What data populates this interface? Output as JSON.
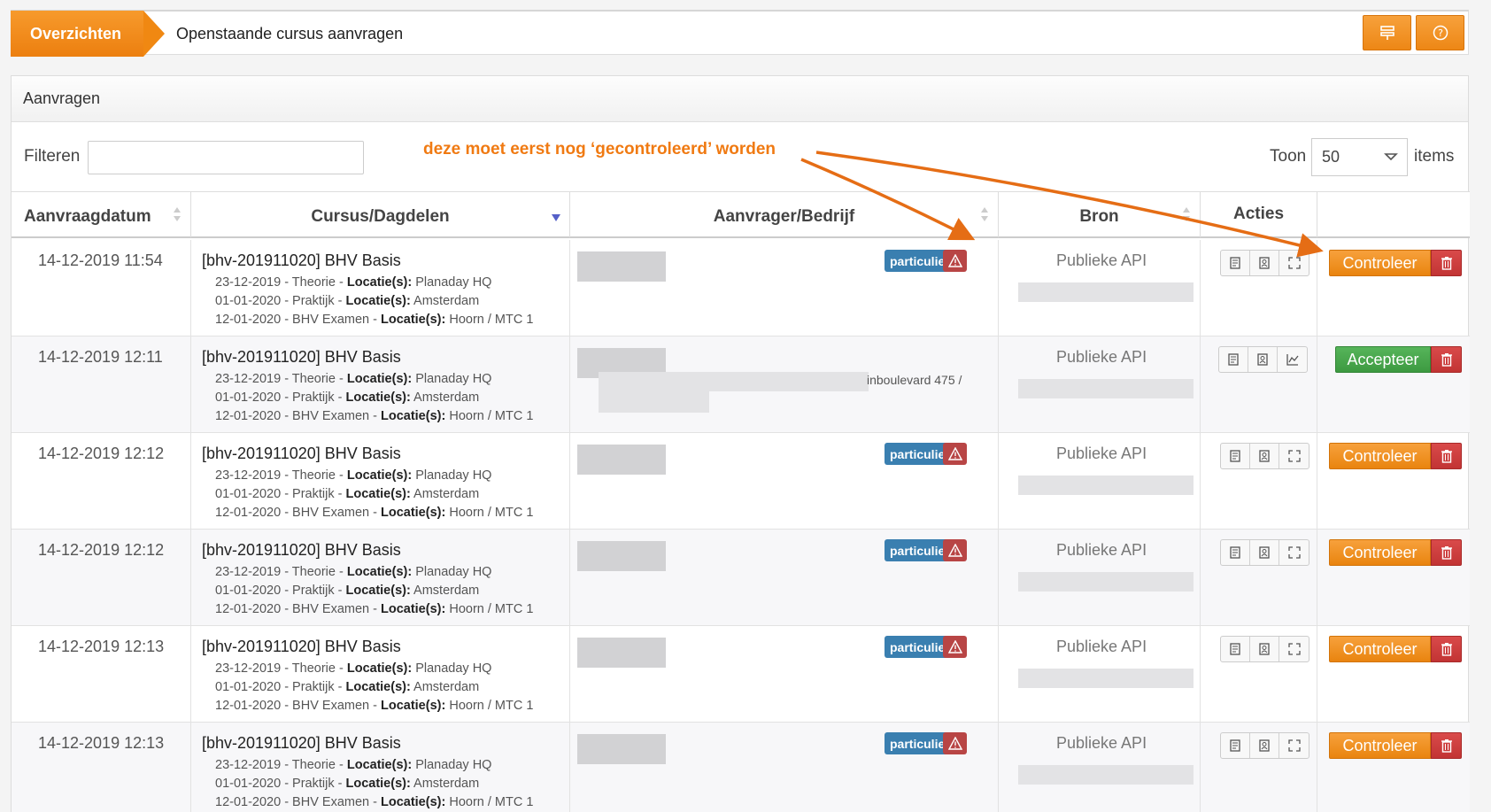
{
  "breadcrumb": {
    "section": "Overzichten",
    "page_title": "Openstaande cursus aanvragen"
  },
  "toolbar": {
    "icons": [
      "filter-icon",
      "help-icon"
    ]
  },
  "panel": {
    "title": "Aanvragen"
  },
  "filter": {
    "label": "Filteren",
    "value": "",
    "placeholder": ""
  },
  "paging": {
    "toon_label": "Toon",
    "selected": "50",
    "items_label": "items"
  },
  "annotation": {
    "text": "deze moet eerst nog ‘gecontroleerd’ worden"
  },
  "table": {
    "headers": {
      "date": "Aanvraagdatum",
      "course": "Cursus/Dagdelen",
      "applicant": "Aanvrager/Bedrijf",
      "source": "Bron",
      "actions": "Acties"
    },
    "rows": [
      {
        "date": "14-12-2019 11:54",
        "course": "[bhv-201911020] BHV Basis",
        "sessions": [
          {
            "date_type": "23-12-2019 - Theorie - ",
            "loc_label": "Locatie(s):",
            "loc": " Planaday HQ"
          },
          {
            "date_type": "01-01-2020 - Praktijk - ",
            "loc_label": "Locatie(s):",
            "loc": " Amsterdam"
          },
          {
            "date_type": "12-01-2020 - BHV Examen - ",
            "loc_label": "Locatie(s):",
            "loc": " Hoorn / MTC 1"
          }
        ],
        "badge": "particulier",
        "source": "Publieke API",
        "action": "Controleer"
      },
      {
        "date": "14-12-2019 12:11",
        "course": "[bhv-201911020] BHV Basis",
        "sessions": [
          {
            "date_type": "23-12-2019 - Theorie - ",
            "loc_label": "Locatie(s):",
            "loc": " Planaday HQ"
          },
          {
            "date_type": "01-01-2020 - Praktijk - ",
            "loc_label": "Locatie(s):",
            "loc": " Amsterdam"
          },
          {
            "date_type": "12-01-2020 - BHV Examen - ",
            "loc_label": "Locatie(s):",
            "loc": " Hoorn / MTC 1"
          }
        ],
        "address_fragment": "inboulevard 475 /",
        "source": "Publieke API",
        "action": "Accepteer"
      },
      {
        "date": "14-12-2019 12:12",
        "course": "[bhv-201911020] BHV Basis",
        "sessions": [
          {
            "date_type": "23-12-2019 - Theorie - ",
            "loc_label": "Locatie(s):",
            "loc": " Planaday HQ"
          },
          {
            "date_type": "01-01-2020 - Praktijk - ",
            "loc_label": "Locatie(s):",
            "loc": " Amsterdam"
          },
          {
            "date_type": "12-01-2020 - BHV Examen - ",
            "loc_label": "Locatie(s):",
            "loc": " Hoorn / MTC 1"
          }
        ],
        "badge": "particulier",
        "source": "Publieke API",
        "action": "Controleer"
      },
      {
        "date": "14-12-2019 12:12",
        "course": "[bhv-201911020] BHV Basis",
        "sessions": [
          {
            "date_type": "23-12-2019 - Theorie - ",
            "loc_label": "Locatie(s):",
            "loc": " Planaday HQ"
          },
          {
            "date_type": "01-01-2020 - Praktijk - ",
            "loc_label": "Locatie(s):",
            "loc": " Amsterdam"
          },
          {
            "date_type": "12-01-2020 - BHV Examen - ",
            "loc_label": "Locatie(s):",
            "loc": " Hoorn / MTC 1"
          }
        ],
        "badge": "particulier",
        "source": "Publieke API",
        "action": "Controleer"
      },
      {
        "date": "14-12-2019 12:13",
        "course": "[bhv-201911020] BHV Basis",
        "sessions": [
          {
            "date_type": "23-12-2019 - Theorie - ",
            "loc_label": "Locatie(s):",
            "loc": " Planaday HQ"
          },
          {
            "date_type": "01-01-2020 - Praktijk - ",
            "loc_label": "Locatie(s):",
            "loc": " Amsterdam"
          },
          {
            "date_type": "12-01-2020 - BHV Examen - ",
            "loc_label": "Locatie(s):",
            "loc": " Hoorn / MTC 1"
          }
        ],
        "badge": "particulier",
        "source": "Publieke API",
        "action": "Controleer"
      },
      {
        "date": "14-12-2019 12:13",
        "course": "[bhv-201911020] BHV Basis",
        "sessions": [
          {
            "date_type": "23-12-2019 - Theorie - ",
            "loc_label": "Locatie(s):",
            "loc": " Planaday HQ"
          },
          {
            "date_type": "01-01-2020 - Praktijk - ",
            "loc_label": "Locatie(s):",
            "loc": " Amsterdam"
          },
          {
            "date_type": "12-01-2020 - BHV Examen - ",
            "loc_label": "Locatie(s):",
            "loc": " Hoorn / MTC 1"
          }
        ],
        "badge": "particulier",
        "source": "Publieke API",
        "action": "Controleer"
      }
    ]
  },
  "colors": {
    "accent": "#f08812",
    "badge": "#3a7fb0",
    "warning": "#b84545",
    "accept": "#4aa84e",
    "delete": "#c93a3a"
  }
}
